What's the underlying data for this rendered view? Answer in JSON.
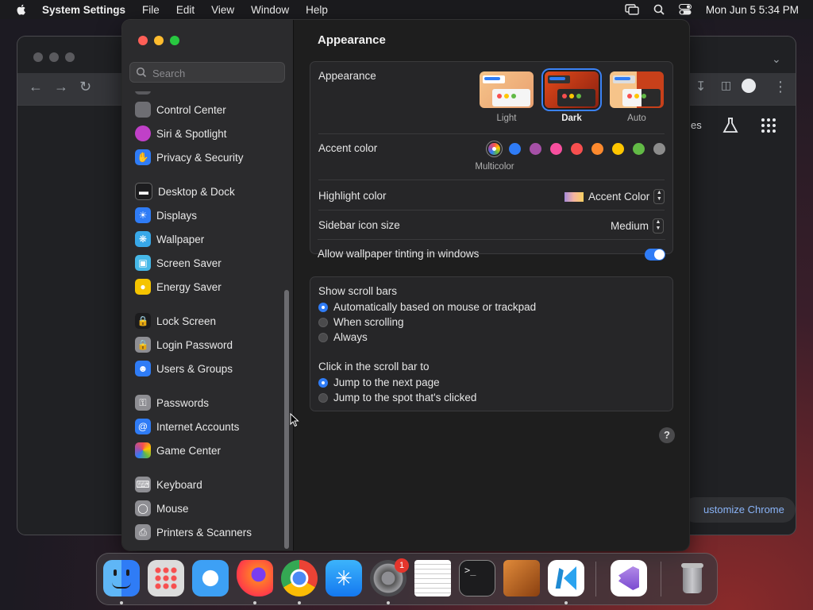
{
  "menubar": {
    "app_name": "System Settings",
    "menus": [
      "File",
      "Edit",
      "View",
      "Window",
      "Help"
    ],
    "clock": "Mon Jun 5  5:34 PM"
  },
  "background_window": {
    "customize_label": "ustomize Chrome",
    "partial_text": "es"
  },
  "sidebar": {
    "search_placeholder": "Search",
    "items": [
      {
        "label": "Control Center",
        "icon": "control-center-icon",
        "color": "#6e6e73"
      },
      {
        "label": "Siri & Spotlight",
        "icon": "siri-icon",
        "color": "#c040c8"
      },
      {
        "label": "Privacy & Security",
        "icon": "hand-icon",
        "color": "#2f7cf6"
      },
      {
        "label": "Desktop & Dock",
        "icon": "dock-icon",
        "color": "#1c1c1e"
      },
      {
        "label": "Displays",
        "icon": "sun-icon",
        "color": "#2f7cf6"
      },
      {
        "label": "Wallpaper",
        "icon": "flower-icon",
        "color": "#38a8e8"
      },
      {
        "label": "Screen Saver",
        "icon": "screen-saver-icon",
        "color": "#46b8e8"
      },
      {
        "label": "Energy Saver",
        "icon": "bulb-icon",
        "color": "#f5c400"
      },
      {
        "label": "Lock Screen",
        "icon": "lock-icon",
        "color": "#1c1c1e"
      },
      {
        "label": "Login Password",
        "icon": "lock-icon",
        "color": "#8e8e93"
      },
      {
        "label": "Users & Groups",
        "icon": "users-icon",
        "color": "#2f7cf6"
      },
      {
        "label": "Passwords",
        "icon": "key-icon",
        "color": "#8e8e93"
      },
      {
        "label": "Internet Accounts",
        "icon": "at-icon",
        "color": "#2f7cf6"
      },
      {
        "label": "Game Center",
        "icon": "game-center-icon",
        "color": "#ffffff"
      },
      {
        "label": "Keyboard",
        "icon": "keyboard-icon",
        "color": "#8e8e93"
      },
      {
        "label": "Mouse",
        "icon": "mouse-icon",
        "color": "#8e8e93"
      },
      {
        "label": "Printers & Scanners",
        "icon": "printer-icon",
        "color": "#8e8e93"
      }
    ]
  },
  "main": {
    "title": "Appearance",
    "appearance": {
      "label": "Appearance",
      "options": [
        {
          "label": "Light",
          "selected": false
        },
        {
          "label": "Dark",
          "selected": true
        },
        {
          "label": "Auto",
          "selected": false
        }
      ]
    },
    "accent": {
      "label": "Accent color",
      "selected_label": "Multicolor",
      "colors": [
        "multicolor",
        "#2f7cf6",
        "#a550a7",
        "#f74f9e",
        "#f74f4f",
        "#fd8a2e",
        "#ffc600",
        "#62ba46",
        "#8c8c8c"
      ]
    },
    "highlight": {
      "label": "Highlight color",
      "value": "Accent Color"
    },
    "icon_size": {
      "label": "Sidebar icon size",
      "value": "Medium"
    },
    "tinting": {
      "label": "Allow wallpaper tinting in windows",
      "on": true
    },
    "scroll_bars": {
      "label": "Show scroll bars",
      "options": [
        {
          "label": "Automatically based on mouse or trackpad",
          "selected": true
        },
        {
          "label": "When scrolling",
          "selected": false
        },
        {
          "label": "Always",
          "selected": false
        }
      ]
    },
    "click_scroll": {
      "label": "Click in the scroll bar to",
      "options": [
        {
          "label": "Jump to the next page",
          "selected": true
        },
        {
          "label": "Jump to the spot that's clicked",
          "selected": false
        }
      ]
    },
    "help": "?"
  },
  "dock": {
    "apps": [
      "Finder",
      "Launchpad",
      "Safari",
      "Firefox",
      "Chrome",
      "App Store",
      "System Settings",
      "TextEdit",
      "Terminal",
      "GarageBand",
      "Visual Studio Code",
      "Visual Studio",
      "Trash"
    ],
    "settings_badge": "1"
  }
}
